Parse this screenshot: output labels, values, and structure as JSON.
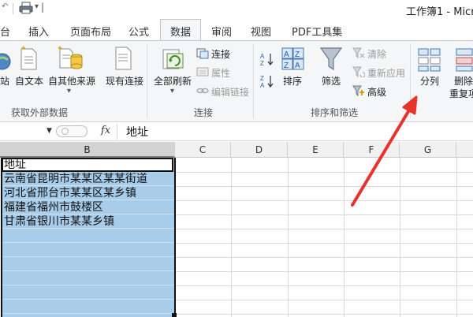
{
  "window": {
    "title": "工作簿1 - Micr"
  },
  "tabs": [
    {
      "label": "台"
    },
    {
      "label": "插入"
    },
    {
      "label": "页面布局"
    },
    {
      "label": "公式"
    },
    {
      "label": "数据",
      "active": true
    },
    {
      "label": "审阅"
    },
    {
      "label": "视图"
    },
    {
      "label": "PDF工具集"
    }
  ],
  "ribbon": {
    "external_data": {
      "group_label": "获取外部数据",
      "btn_web": "站",
      "btn_text": "自文本",
      "btn_other": "自其他来源",
      "btn_existing": "现有连接"
    },
    "connections": {
      "group_label": "连接",
      "btn_refresh_all": "全部刷新",
      "link_connections": "连接",
      "link_properties": "属性",
      "link_edit_links": "编辑链接"
    },
    "sort_filter": {
      "group_label": "排序和筛选",
      "btn_sort": "排序",
      "btn_filter": "筛选",
      "link_clear": "清除",
      "link_reapply": "重新应用",
      "link_advanced": "高级"
    },
    "data_tools": {
      "btn_split": "分列",
      "btn_remove": "删除",
      "btn_remove_line2": "重复项"
    }
  },
  "formula_bar": {
    "fx_label": "fx",
    "value": "地址"
  },
  "sheet": {
    "columns": [
      "B",
      "C",
      "D",
      "E",
      "F",
      "G"
    ],
    "selected_column": "B",
    "cells_B": [
      "地址",
      "云南省昆明市某某区某某街道",
      "河北省邢台市某某区某乡镇",
      "福建省福州市鼓楼区",
      "甘肃省银川市某某乡镇"
    ]
  },
  "colors": {
    "selection_fill": "#a8cdea",
    "annotation_arrow": "#e8322d"
  }
}
